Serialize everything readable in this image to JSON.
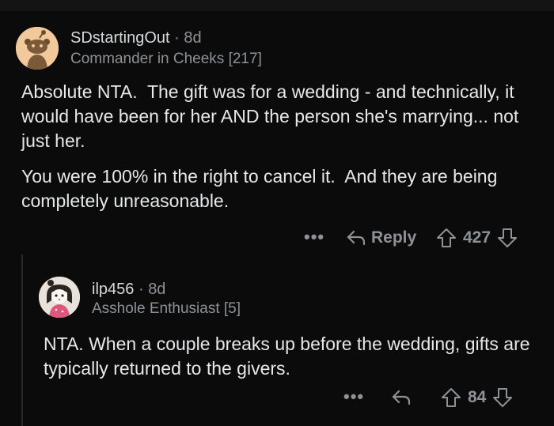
{
  "comments": [
    {
      "username": "SDstartingOut",
      "separator": "·",
      "age": "8d",
      "flair": "Commander in Cheeks [217]",
      "paragraphs": [
        "Absolute NTA.  The gift was for a wedding - and technically, it would have been for her AND the person she's marrying... not just her.",
        "You were 100% in the right to cancel it.  And they are being completely unreasonable."
      ],
      "actions": {
        "more": "•••",
        "reply_label": "Reply",
        "score": "427"
      },
      "avatar_color": "#f2c99b"
    },
    {
      "username": "ilp456",
      "separator": "·",
      "age": "8d",
      "flair": "Asshole Enthusiast [5]",
      "paragraphs": [
        "NTA. When a couple breaks up before the wedding, gifts are typically returned to the givers."
      ],
      "actions": {
        "more": "•••",
        "score": "84"
      },
      "avatar_color": "#e8e2da"
    }
  ],
  "icons": {
    "reply": "reply-arrow-icon",
    "upvote": "upvote-arrow-icon",
    "downvote": "downvote-arrow-icon",
    "more": "more-dots-icon"
  },
  "colors": {
    "background": "#0b0b0b",
    "text": "#e6e8ea",
    "muted": "#8e9296"
  }
}
